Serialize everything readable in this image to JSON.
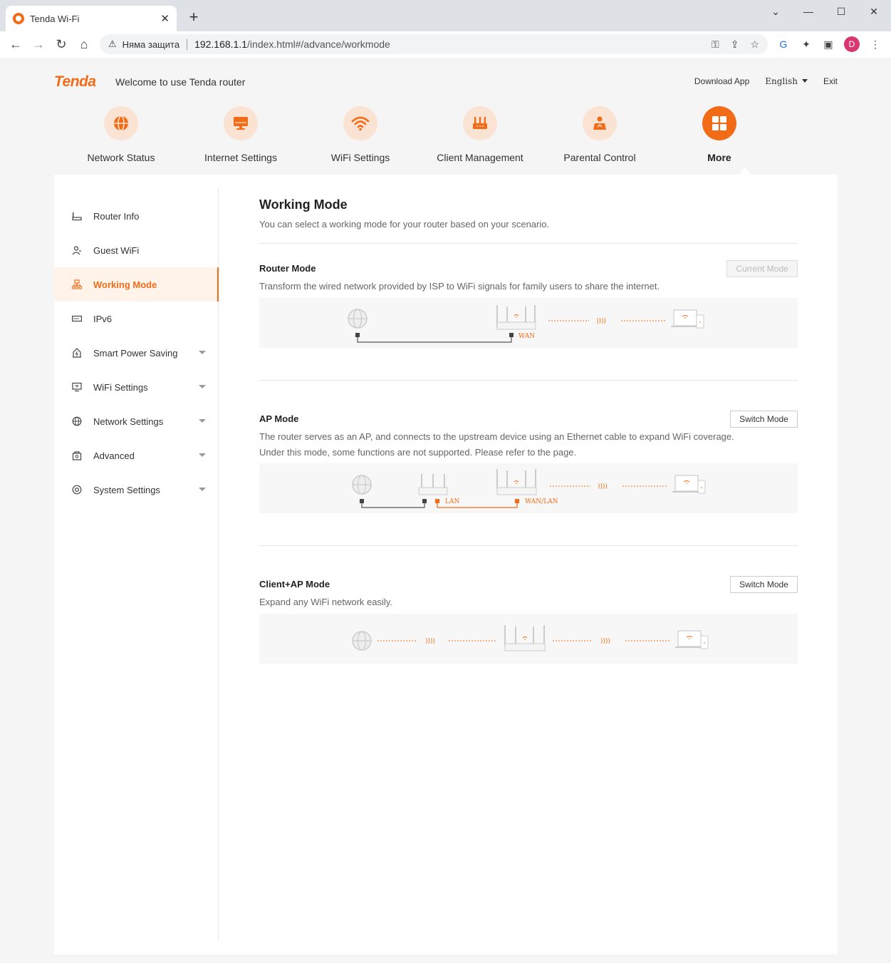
{
  "browser": {
    "tab_title": "Tenda Wi-Fi",
    "security_label": "Няма защита",
    "url_host": "192.168.1.1",
    "url_path": "/index.html#/advance/workmode",
    "profile_initial": "D"
  },
  "header": {
    "logo": "Tenda",
    "welcome": "Welcome to use Tenda router",
    "download_app": "Download App",
    "language": "English",
    "exit": "Exit"
  },
  "topnav": [
    {
      "label": "Network Status",
      "icon": "globe-icon"
    },
    {
      "label": "Internet Settings",
      "icon": "monitor-icon"
    },
    {
      "label": "WiFi Settings",
      "icon": "wifi-icon"
    },
    {
      "label": "Client Management",
      "icon": "router-icon"
    },
    {
      "label": "Parental Control",
      "icon": "parental-icon"
    },
    {
      "label": "More",
      "icon": "grid-icon",
      "active": true
    }
  ],
  "sidebar": [
    {
      "label": "Router Info",
      "icon": "router-info-icon"
    },
    {
      "label": "Guest WiFi",
      "icon": "guest-icon"
    },
    {
      "label": "Working Mode",
      "icon": "working-mode-icon",
      "active": true
    },
    {
      "label": "IPv6",
      "icon": "ipv6-icon"
    },
    {
      "label": "Smart Power Saving",
      "icon": "power-saving-icon",
      "expandable": true
    },
    {
      "label": "WiFi Settings",
      "icon": "wifi-settings-icon",
      "expandable": true
    },
    {
      "label": "Network Settings",
      "icon": "network-icon",
      "expandable": true
    },
    {
      "label": "Advanced",
      "icon": "advanced-icon",
      "expandable": true
    },
    {
      "label": "System Settings",
      "icon": "system-icon",
      "expandable": true
    }
  ],
  "content": {
    "title": "Working Mode",
    "subtitle": "You can select a working mode for your router based on your scenario.",
    "modes": [
      {
        "title": "Router Mode",
        "desc": [
          "Transform the wired network provided by ISP to WiFi signals for family users to share the internet."
        ],
        "button": "Current Mode",
        "button_disabled": true,
        "port_labels": [
          "WAN"
        ]
      },
      {
        "title": "AP Mode",
        "desc": [
          "The router serves as an AP, and connects to the upstream device using an Ethernet cable to expand WiFi coverage.",
          "Under this mode, some functions are not supported. Please refer to the page."
        ],
        "button": "Switch Mode",
        "button_disabled": false,
        "port_labels": [
          "LAN",
          "WAN/LAN"
        ]
      },
      {
        "title": "Client+AP Mode",
        "desc": [
          "Expand any WiFi network easily."
        ],
        "button": "Switch Mode",
        "button_disabled": false,
        "port_labels": []
      }
    ]
  },
  "colors": {
    "accent": "#f26c17",
    "accent_light": "#fbe3d3",
    "text": "#333333",
    "muted": "#666666"
  }
}
